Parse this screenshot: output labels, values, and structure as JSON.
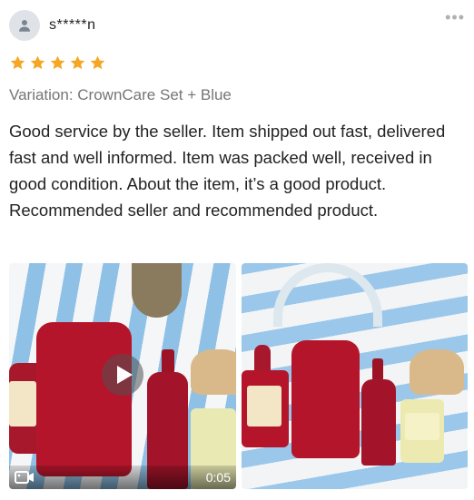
{
  "user": {
    "masked_name": "s*****n",
    "avatar_icon": "user-icon"
  },
  "menu_icon": "more-dots-icon",
  "rating": {
    "stars": 5,
    "max": 5,
    "color": "#f5a623"
  },
  "variation": "Variation: CrownCare Set + Blue",
  "review_text": "Good service by the seller. Item shipped out fast, delivered fast and well informed. Item was packed well, received in good condition. About the item, it’s a good product. Recommended seller and recommended product.",
  "media": {
    "video": {
      "duration": "0:05",
      "play_icon": "play-icon",
      "type_icon": "video-camera-icon"
    },
    "photo": {
      "type": "image"
    }
  },
  "colors": {
    "product_red": "#b5152b",
    "star": "#f5a623",
    "stripe_blue": "#8fc1e6"
  }
}
